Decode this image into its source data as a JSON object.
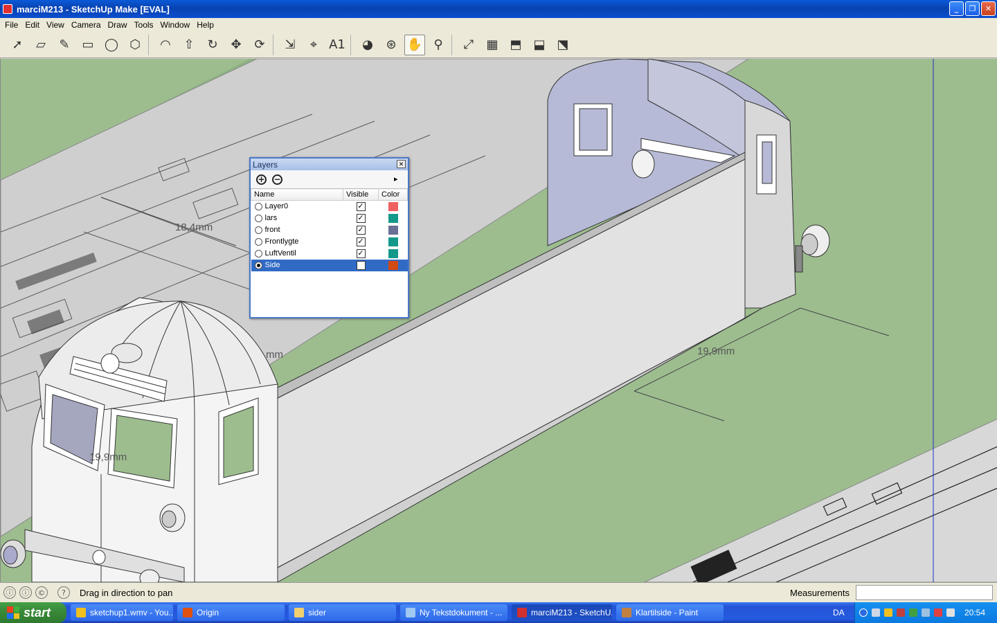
{
  "window": {
    "title": "marciM213 - SketchUp Make [EVAL]",
    "minimize": "_",
    "maximize": "❐",
    "close": "✕"
  },
  "menu": [
    "File",
    "Edit",
    "View",
    "Camera",
    "Draw",
    "Tools",
    "Window",
    "Help"
  ],
  "toolbar": {
    "tools": [
      {
        "name": "select-tool",
        "glyph": "➚"
      },
      {
        "name": "eraser-tool",
        "glyph": "▱"
      },
      {
        "name": "pencil-tool",
        "glyph": "✎"
      },
      {
        "name": "rectangle-tool",
        "glyph": "▭"
      },
      {
        "name": "circle-tool",
        "glyph": "◯"
      },
      {
        "name": "polygon-tool",
        "glyph": "⬡"
      },
      {
        "name": "arc-tool",
        "glyph": "◠"
      },
      {
        "name": "push-pull-tool",
        "glyph": "⇧"
      },
      {
        "name": "follow-me-tool",
        "glyph": "↻"
      },
      {
        "name": "move-tool",
        "glyph": "✥"
      },
      {
        "name": "rotate-tool",
        "glyph": "⟳"
      },
      {
        "name": "scale-tool",
        "glyph": "⇲"
      },
      {
        "name": "tape-measure-tool",
        "glyph": "⌖"
      },
      {
        "name": "text-tool",
        "glyph": "A1"
      },
      {
        "name": "paint-bucket-tool",
        "glyph": "◕"
      },
      {
        "name": "orbit-tool",
        "glyph": "⊛"
      },
      {
        "name": "pan-tool",
        "glyph": "✋"
      },
      {
        "name": "zoom-tool",
        "glyph": "⚲"
      },
      {
        "name": "zoom-extents-tool",
        "glyph": "⤢"
      },
      {
        "name": "warehouse-tool",
        "glyph": "▦"
      },
      {
        "name": "get-models-tool",
        "glyph": "⬒"
      },
      {
        "name": "share-model-tool",
        "glyph": "⬓"
      },
      {
        "name": "extension-warehouse-tool",
        "glyph": "⬔"
      }
    ]
  },
  "viewport": {
    "dimensions": [
      "18,4mm",
      "mm",
      "19,9mm",
      "19,9mm"
    ]
  },
  "layers": {
    "title": "Layers",
    "add_glyph": "+",
    "remove_glyph": "−",
    "detail_glyph": "▸",
    "columns": {
      "name": "Name",
      "visible": "Visible",
      "color": "Color"
    },
    "check": "✓",
    "rows": [
      {
        "name": "Layer0",
        "active": false,
        "visible": true,
        "color": "#f06060"
      },
      {
        "name": "lars",
        "active": false,
        "visible": true,
        "color": "#13998a"
      },
      {
        "name": "front",
        "active": false,
        "visible": true,
        "color": "#6a6f96"
      },
      {
        "name": "Frontlygte",
        "active": false,
        "visible": true,
        "color": "#13998a"
      },
      {
        "name": "LuftVentil",
        "active": false,
        "visible": true,
        "color": "#13998a"
      },
      {
        "name": "Side",
        "active": true,
        "visible": true,
        "color": "#d04a12"
      }
    ]
  },
  "status": {
    "icons": [
      "ⓘ",
      "ⓘ",
      "©",
      "?"
    ],
    "message": "Drag in direction to pan",
    "measurements_label": "Measurements",
    "measurements_value": ""
  },
  "taskbar": {
    "start": "start",
    "tasks": [
      {
        "label": "sketchup1.wmv - You...",
        "color": "#f0c020",
        "width": 148
      },
      {
        "label": "Origin",
        "color": "#e05010",
        "width": 155
      },
      {
        "label": "sider",
        "color": "#f0d070",
        "width": 155
      },
      {
        "label": "Ny Tekstdokument - ...",
        "color": "#a0c8f0",
        "width": 155
      },
      {
        "label": "marciM213 - SketchU...",
        "color": "#d03030",
        "width": 145,
        "active": true
      },
      {
        "label": "Klartilside - Paint",
        "color": "#c08040",
        "width": 155
      }
    ],
    "lang": "DA",
    "clock": "20:54"
  }
}
